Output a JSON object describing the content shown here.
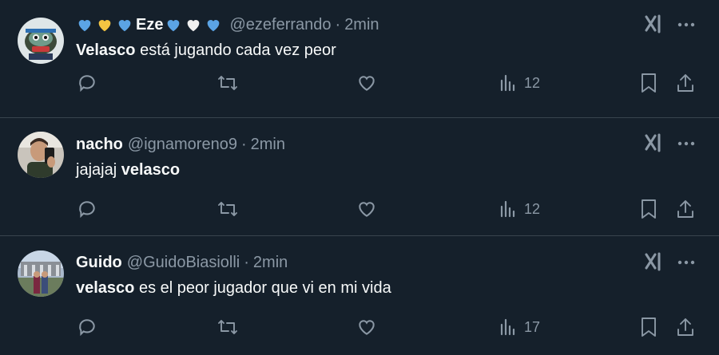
{
  "tweets": [
    {
      "emojis": [
        "blue-heart",
        "yellow-heart",
        "blue-heart"
      ],
      "name": "Eze",
      "emojis_after": [
        "blue-heart",
        "white-heart",
        "blue-heart"
      ],
      "handle": "@ezeferrando",
      "sep": "·",
      "time": "2min",
      "text_bold": "Velasco",
      "text_rest": " está jugando cada vez peor",
      "views": "12"
    },
    {
      "name": "nacho",
      "handle": "@ignamoreno9",
      "sep": "·",
      "time": "2min",
      "text_pre": "jajajaj ",
      "text_bold": "velasco",
      "views": "12"
    },
    {
      "name": "Guido",
      "handle": "@GuidoBiasiolli",
      "sep": "·",
      "time": "2min",
      "text_bold": "velasco",
      "text_rest": " es el peor jugador que vi en mi vida",
      "views": "17"
    }
  ],
  "colors": {
    "background": "#15202b",
    "divider": "#38444d",
    "muted": "#8b98a5",
    "text": "#f7f9f9",
    "blue_heart": "#5ba4e5",
    "yellow_heart": "#f4c542",
    "white_heart": "#f0f0f0"
  },
  "icons": [
    "reply-icon",
    "retweet-icon",
    "like-icon",
    "views-icon",
    "bookmark-icon",
    "share-icon",
    "grok-icon",
    "more-icon"
  ]
}
